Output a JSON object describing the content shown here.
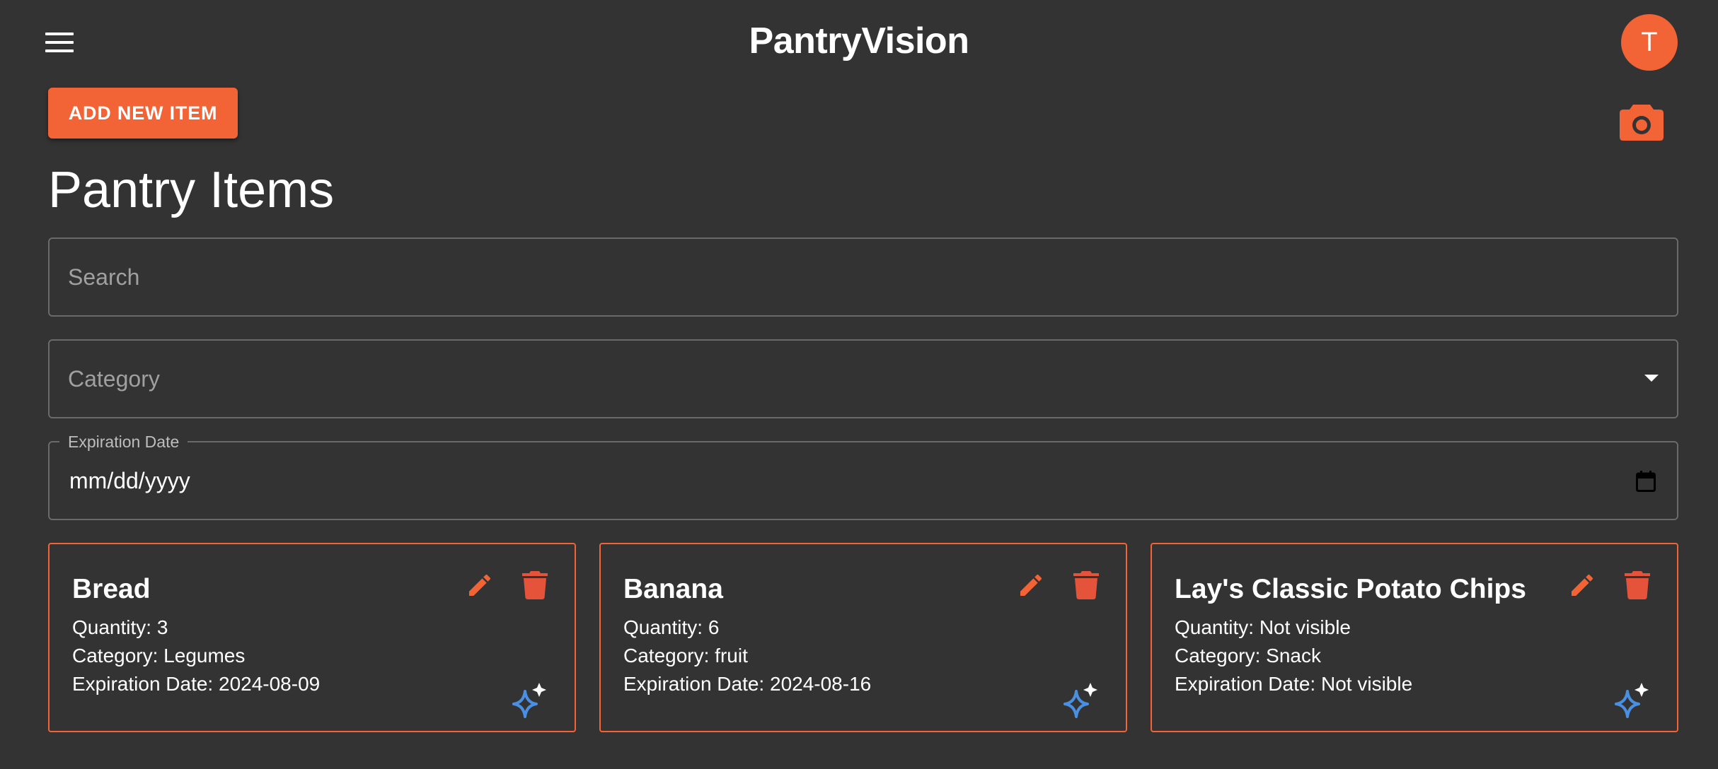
{
  "app": {
    "title": "PantryVision",
    "avatar_initial": "T"
  },
  "colors": {
    "accent": "#f26336",
    "background": "#333333",
    "ai_icon": "#4a90e2",
    "field_border": "#6a6a6a"
  },
  "actions": {
    "add_item_label": "ADD NEW ITEM",
    "camera_icon": "camera-icon",
    "menu_icon": "hamburger-menu-icon"
  },
  "page": {
    "title": "Pantry Items"
  },
  "filters": {
    "search_placeholder": "Search",
    "category_placeholder": "Category",
    "expiration_label": "Expiration Date",
    "expiration_value": "mm/dd/yyyy"
  },
  "items": [
    {
      "name": "Bread",
      "quantity": "Quantity: 3",
      "category": "Category: Legumes",
      "expiration": "Expiration Date: 2024-08-09"
    },
    {
      "name": "Banana",
      "quantity": "Quantity: 6",
      "category": "Category: fruit",
      "expiration": "Expiration Date: 2024-08-16"
    },
    {
      "name": "Lay's Classic Potato Chips",
      "quantity": "Quantity: Not visible",
      "category": "Category: Snack",
      "expiration": "Expiration Date: Not visible"
    }
  ]
}
